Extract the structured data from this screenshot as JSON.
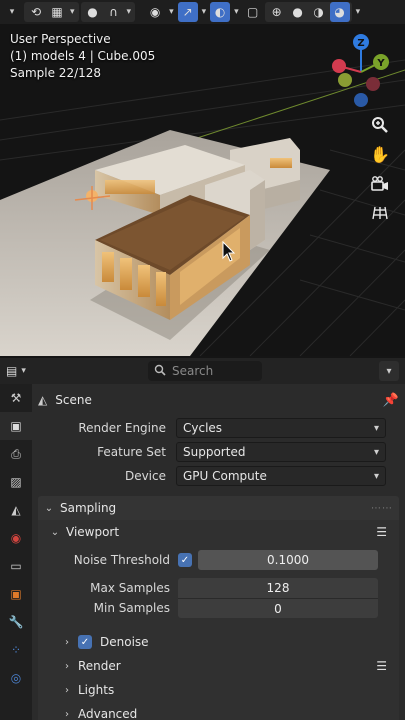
{
  "viewport": {
    "overlay": {
      "perspective": "User Perspective",
      "object_info": "(1) models 4 | Cube.005",
      "sample": "Sample 22/128"
    },
    "gizmo": {
      "z": "Z",
      "y": "Y"
    },
    "tools": [
      "zoom-icon",
      "hand-pan-icon",
      "camera-icon",
      "grid-icon"
    ]
  },
  "properties": {
    "search": {
      "placeholder": "Search"
    },
    "context": {
      "title": "Scene"
    },
    "render": {
      "engine_label": "Render Engine",
      "engine_value": "Cycles",
      "feature_label": "Feature Set",
      "feature_value": "Supported",
      "device_label": "Device",
      "device_value": "GPU Compute"
    },
    "sampling": {
      "title": "Sampling",
      "viewport": {
        "title": "Viewport",
        "noise_label": "Noise Threshold",
        "noise_value": "0.1000",
        "max_label": "Max Samples",
        "max_value": "128",
        "min_label": "Min Samples",
        "min_value": "0"
      },
      "denoise": "Denoise",
      "render": "Render",
      "lights": "Lights",
      "advanced": "Advanced"
    }
  },
  "colors": {
    "accent": "#4772b3",
    "axis_x": "#d33b4f",
    "axis_y": "#7aa32a",
    "axis_z": "#2f7be0"
  }
}
